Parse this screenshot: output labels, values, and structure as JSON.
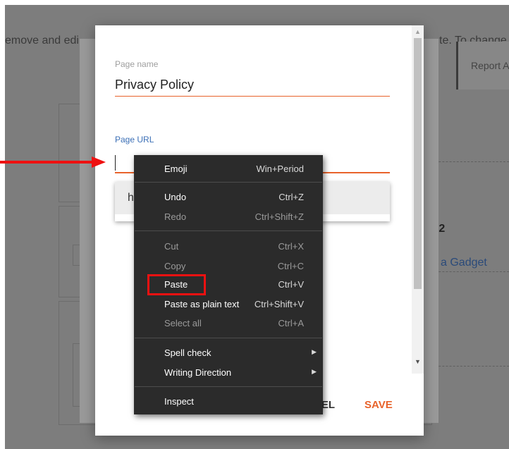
{
  "background": {
    "instruction_left": "emove and edi",
    "instruction_right": "te. To change",
    "tab_label": "Report A",
    "section_label": "-2",
    "gadget_link": "l a Gadget"
  },
  "dialog": {
    "page_name_label": "Page name",
    "page_name_value": "Privacy Policy",
    "page_url_label": "Page URL",
    "page_url_value": "",
    "suggestion_text": "h",
    "cancel_label": "CEL",
    "save_label": "SAVE"
  },
  "context_menu": {
    "items": [
      {
        "label": "Emoji",
        "shortcut": "Win+Period"
      },
      {
        "label": "Undo",
        "shortcut": "Ctrl+Z"
      },
      {
        "label": "Redo",
        "shortcut": "Ctrl+Shift+Z"
      },
      {
        "label": "Cut",
        "shortcut": "Ctrl+X"
      },
      {
        "label": "Copy",
        "shortcut": "Ctrl+C"
      },
      {
        "label": "Paste",
        "shortcut": "Ctrl+V"
      },
      {
        "label": "Paste as plain text",
        "shortcut": "Ctrl+Shift+V"
      },
      {
        "label": "Select all",
        "shortcut": "Ctrl+A"
      },
      {
        "label": "Spell check",
        "shortcut": ""
      },
      {
        "label": "Writing Direction",
        "shortcut": ""
      },
      {
        "label": "Inspect",
        "shortcut": ""
      }
    ]
  },
  "annotations": {
    "highlighted_item": "Paste",
    "arrow_target": "Page URL field"
  },
  "colors": {
    "accent": "#e8632b",
    "link_label": "#3b6fb6",
    "annotation_red": "#ee1111",
    "menu_bg": "#2b2b2b"
  },
  "icons": {
    "submenu_arrow": "chevron-right-icon",
    "scroll_up": "triangle-up-icon",
    "scroll_down": "triangle-down-icon"
  }
}
